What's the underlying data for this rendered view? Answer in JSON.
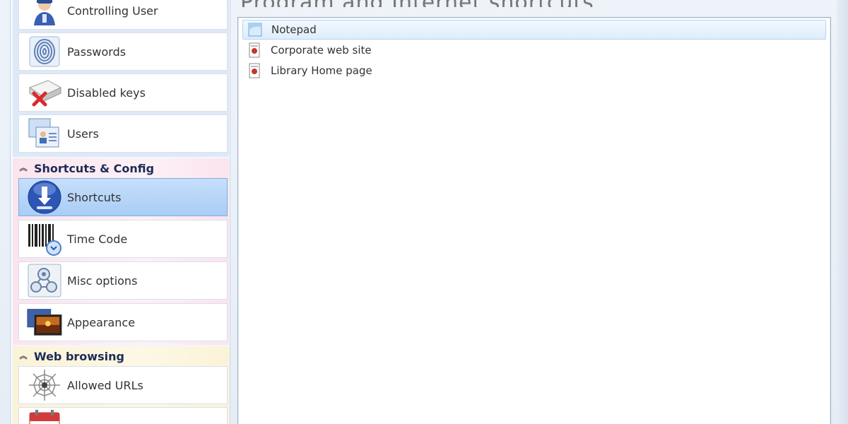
{
  "main": {
    "title": "Program and Internet shortcuts",
    "list": [
      {
        "label": "Notepad",
        "icon": "notepad-icon",
        "highlighted": true
      },
      {
        "label": "Corporate web site",
        "icon": "web-shortcut-icon",
        "highlighted": false
      },
      {
        "label": "Library Home page",
        "icon": "web-shortcut-icon",
        "highlighted": false
      }
    ]
  },
  "sidebar": {
    "groups": [
      {
        "items": [
          {
            "label": "Controlling User",
            "icon": "user-icon"
          },
          {
            "label": "Passwords",
            "icon": "fingerprint-icon"
          },
          {
            "label": "Disabled keys",
            "icon": "disabled-keys-icon"
          },
          {
            "label": "Users",
            "icon": "users-icon"
          }
        ]
      },
      {
        "title": "Shortcuts & Config",
        "items": [
          {
            "label": "Shortcuts",
            "icon": "shortcut-arrow-icon",
            "selected": true
          },
          {
            "label": "Time Code",
            "icon": "barcode-clock-icon"
          },
          {
            "label": "Misc options",
            "icon": "misc-options-icon"
          },
          {
            "label": "Appearance",
            "icon": "appearance-icon"
          }
        ]
      },
      {
        "title": "Web browsing",
        "items": [
          {
            "label": "Allowed URLs",
            "icon": "web-spider-icon"
          },
          {
            "label": "",
            "icon": "calendar-icon"
          }
        ]
      }
    ]
  },
  "colors": {
    "selected_item": "#a9cdf5",
    "group1_bg": "#dde9f7",
    "group2_bg": "#fbe4ee",
    "group3_bg": "#fbf3d7",
    "header_text": "#1d2c55"
  }
}
